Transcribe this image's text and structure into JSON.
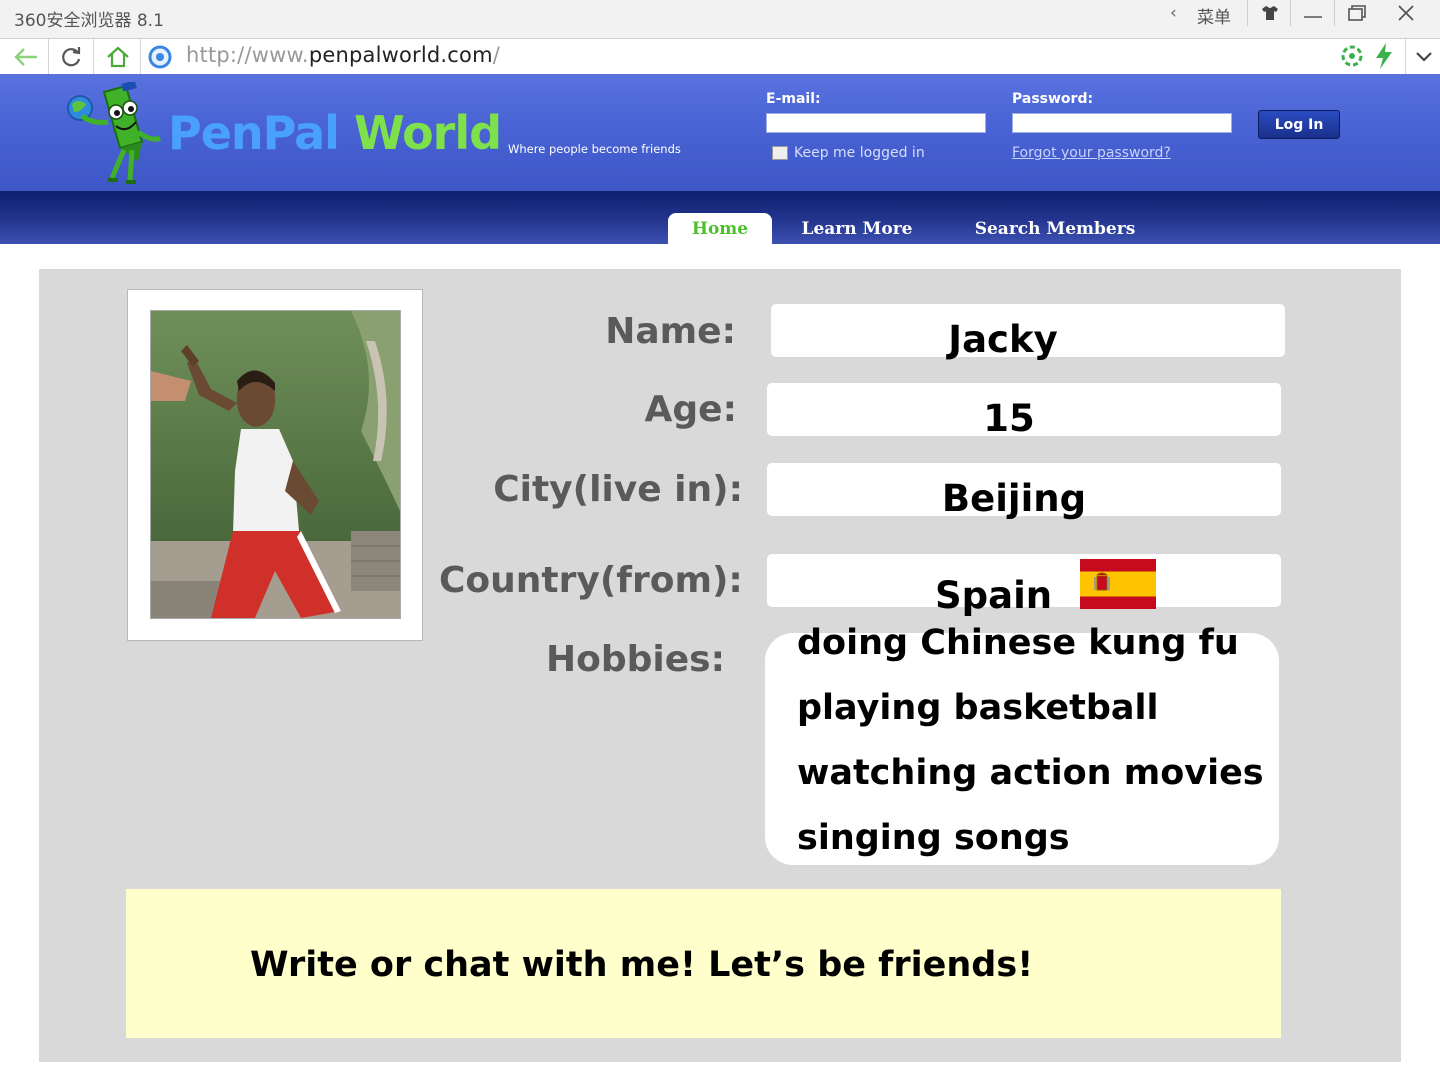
{
  "window": {
    "title": "360安全浏览器 8.1",
    "menu_label": "菜单"
  },
  "address_bar": {
    "url_prefix": "http://www.",
    "url_host": "penpalworld.com",
    "url_suffix": "/"
  },
  "site": {
    "logo_pen": "PenPal",
    "logo_world": "World",
    "tagline": "Where people become friends",
    "login": {
      "email_label": "E-mail:",
      "password_label": "Password:",
      "keep_logged_in": "Keep me logged in",
      "forgot_password": "Forgot your password?",
      "login_button": "Log In"
    },
    "nav": {
      "home": "Home",
      "learn_more": "Learn More",
      "search_members": "Search Members"
    }
  },
  "profile": {
    "name_label": "Name:",
    "name": "Jacky",
    "age_label": "Age:",
    "age": "15",
    "city_label": "City(live in):",
    "city": "Beijing",
    "country_label": "Country(from):",
    "country": "Spain",
    "hobbies_label": "Hobbies:",
    "hobbies": [
      "doing Chinese kung fu",
      "playing basketball",
      "watching action movies",
      "singing songs"
    ],
    "call_to_action": "Write or chat with me! Let’s be friends!"
  },
  "colors": {
    "header_blue": "#4963d4",
    "nav_dark_blue": "#1a2a80",
    "logo_green": "#7ee04a",
    "card_gray": "#d9d9d9",
    "cta_yellow": "#ffffcc",
    "flag_red": "#c60b1e",
    "flag_yellow": "#ffc400"
  }
}
